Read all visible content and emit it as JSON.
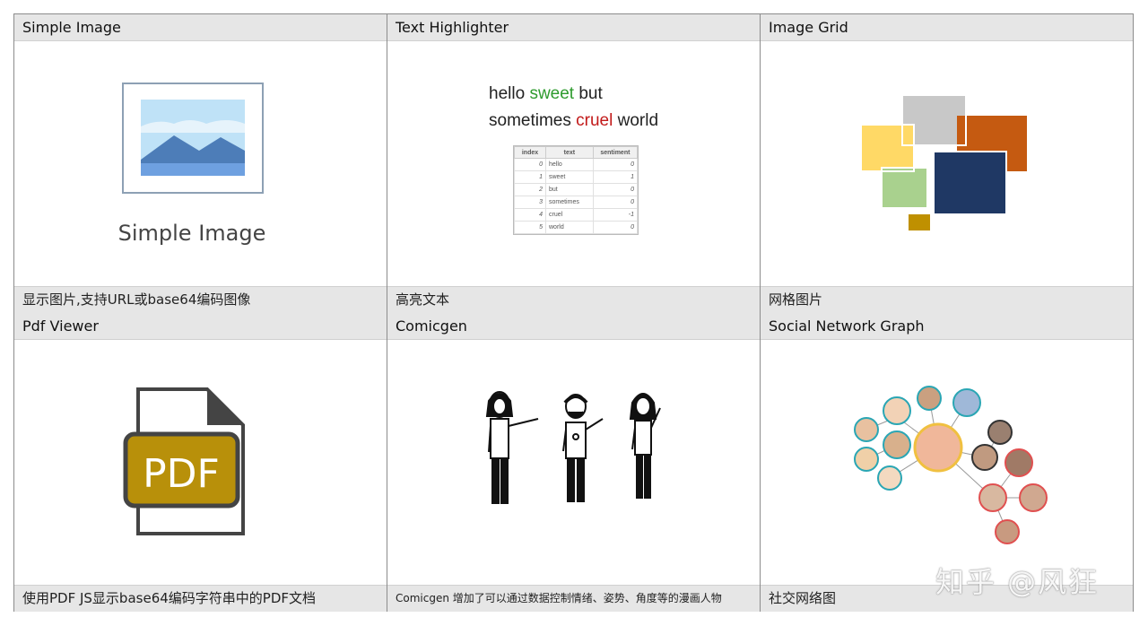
{
  "cards": [
    {
      "title": "Simple Image",
      "caption": "显示图片,支持URL或base64编码图像",
      "placeholder_label": "Simple Image"
    },
    {
      "title": "Text Highlighter",
      "caption": "高亮文本",
      "highlight": {
        "words": [
          "hello",
          "sweet",
          "but",
          "sometimes",
          "cruel",
          "world"
        ]
      },
      "table": {
        "headers": [
          "index",
          "text",
          "sentiment"
        ],
        "rows": [
          [
            "0",
            "hello",
            "0"
          ],
          [
            "1",
            "sweet",
            "1"
          ],
          [
            "2",
            "but",
            "0"
          ],
          [
            "3",
            "sometimes",
            "0"
          ],
          [
            "4",
            "cruel",
            "-1"
          ],
          [
            "5",
            "world",
            "0"
          ]
        ]
      }
    },
    {
      "title": "Image Grid",
      "caption": "网格图片"
    },
    {
      "title": "Pdf Viewer",
      "caption": "使用PDF JS显示base64编码字符串中的PDF文档",
      "icon_label": "PDF"
    },
    {
      "title": "Comicgen",
      "caption": "Comicgen 增加了可以通过数据控制情绪、姿势、角度等的漫画人物"
    },
    {
      "title": "Social Network Graph",
      "caption": "社交网络图"
    }
  ],
  "watermark": "知乎 @风狂",
  "colors": {
    "header_bg": "#e6e6e6",
    "highlight_positive": "#2e9b2e",
    "highlight_negative": "#c21a1a",
    "pdf_gold": "#b8900a"
  }
}
